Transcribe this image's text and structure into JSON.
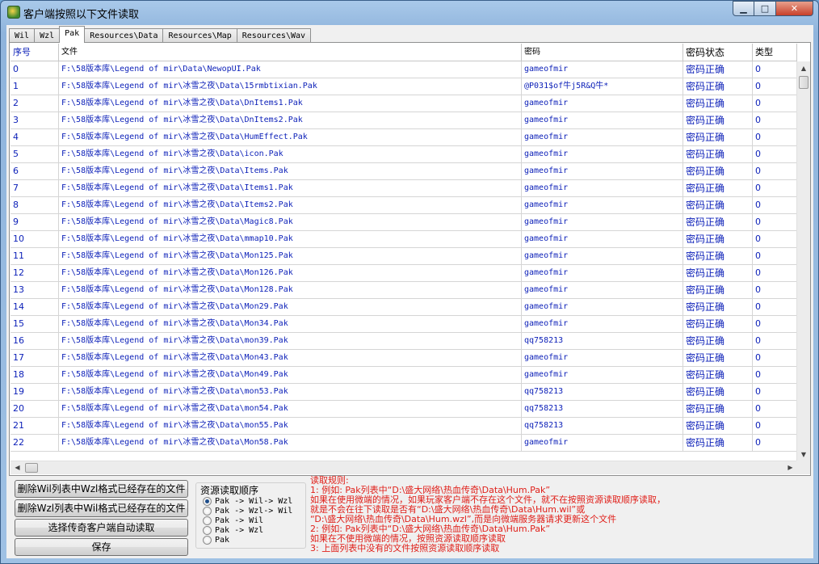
{
  "window": {
    "title": "客户端按照以下文件读取",
    "min_glyph": "▁",
    "max_glyph": "□",
    "close_glyph": "✕"
  },
  "tabs": [
    "Wil",
    "Wzl",
    "Pak",
    "Resources\\Data",
    "Resources\\Map",
    "Resources\\Wav"
  ],
  "active_tab": 2,
  "table": {
    "headers": [
      "序号",
      "文件",
      "密码",
      "密码状态",
      "类型"
    ],
    "rows": [
      [
        "0",
        "F:\\58版本库\\Legend of mir\\Data\\NewopUI.Pak",
        "gameofmir",
        "密码正确",
        "0"
      ],
      [
        "1",
        "F:\\58版本库\\Legend of mir\\冰雪之夜\\Data\\15rmbtixian.Pak",
        "@P031$of牛j5R&Q牛*",
        "密码正确",
        "0"
      ],
      [
        "2",
        "F:\\58版本库\\Legend of mir\\冰雪之夜\\Data\\DnItems1.Pak",
        "gameofmir",
        "密码正确",
        "0"
      ],
      [
        "3",
        "F:\\58版本库\\Legend of mir\\冰雪之夜\\Data\\DnItems2.Pak",
        "gameofmir",
        "密码正确",
        "0"
      ],
      [
        "4",
        "F:\\58版本库\\Legend of mir\\冰雪之夜\\Data\\HumEffect.Pak",
        "gameofmir",
        "密码正确",
        "0"
      ],
      [
        "5",
        "F:\\58版本库\\Legend of mir\\冰雪之夜\\Data\\icon.Pak",
        "gameofmir",
        "密码正确",
        "0"
      ],
      [
        "6",
        "F:\\58版本库\\Legend of mir\\冰雪之夜\\Data\\Items.Pak",
        "gameofmir",
        "密码正确",
        "0"
      ],
      [
        "7",
        "F:\\58版本库\\Legend of mir\\冰雪之夜\\Data\\Items1.Pak",
        "gameofmir",
        "密码正确",
        "0"
      ],
      [
        "8",
        "F:\\58版本库\\Legend of mir\\冰雪之夜\\Data\\Items2.Pak",
        "gameofmir",
        "密码正确",
        "0"
      ],
      [
        "9",
        "F:\\58版本库\\Legend of mir\\冰雪之夜\\Data\\Magic8.Pak",
        "gameofmir",
        "密码正确",
        "0"
      ],
      [
        "10",
        "F:\\58版本库\\Legend of mir\\冰雪之夜\\Data\\mmap10.Pak",
        "gameofmir",
        "密码正确",
        "0"
      ],
      [
        "11",
        "F:\\58版本库\\Legend of mir\\冰雪之夜\\Data\\Mon125.Pak",
        "gameofmir",
        "密码正确",
        "0"
      ],
      [
        "12",
        "F:\\58版本库\\Legend of mir\\冰雪之夜\\Data\\Mon126.Pak",
        "gameofmir",
        "密码正确",
        "0"
      ],
      [
        "13",
        "F:\\58版本库\\Legend of mir\\冰雪之夜\\Data\\Mon128.Pak",
        "gameofmir",
        "密码正确",
        "0"
      ],
      [
        "14",
        "F:\\58版本库\\Legend of mir\\冰雪之夜\\Data\\Mon29.Pak",
        "gameofmir",
        "密码正确",
        "0"
      ],
      [
        "15",
        "F:\\58版本库\\Legend of mir\\冰雪之夜\\Data\\Mon34.Pak",
        "gameofmir",
        "密码正确",
        "0"
      ],
      [
        "16",
        "F:\\58版本库\\Legend of mir\\冰雪之夜\\Data\\mon39.Pak",
        "qq758213",
        "密码正确",
        "0"
      ],
      [
        "17",
        "F:\\58版本库\\Legend of mir\\冰雪之夜\\Data\\Mon43.Pak",
        "gameofmir",
        "密码正确",
        "0"
      ],
      [
        "18",
        "F:\\58版本库\\Legend of mir\\冰雪之夜\\Data\\Mon49.Pak",
        "gameofmir",
        "密码正确",
        "0"
      ],
      [
        "19",
        "F:\\58版本库\\Legend of mir\\冰雪之夜\\Data\\mon53.Pak",
        "qq758213",
        "密码正确",
        "0"
      ],
      [
        "20",
        "F:\\58版本库\\Legend of mir\\冰雪之夜\\Data\\mon54.Pak",
        "qq758213",
        "密码正确",
        "0"
      ],
      [
        "21",
        "F:\\58版本库\\Legend of mir\\冰雪之夜\\Data\\mon55.Pak",
        "qq758213",
        "密码正确",
        "0"
      ],
      [
        "22",
        "F:\\58版本库\\Legend of mir\\冰雪之夜\\Data\\Mon58.Pak",
        "gameofmir",
        "密码正确",
        "0"
      ]
    ]
  },
  "buttons": {
    "delete_wil": "删除Wil列表中Wzl格式已经存在的文件",
    "delete_wzl": "删除Wzl列表中Wil格式已经存在的文件",
    "select_client": "选择传奇客户端自动读取",
    "save": "保存"
  },
  "order": {
    "title": "资源读取顺序",
    "options": [
      "Pak -> Wil-> Wzl",
      "Pak -> Wzl-> Wil",
      "Pak -> Wil",
      "Pak -> Wzl",
      "Pak"
    ],
    "selected": 0
  },
  "rules": {
    "lines": [
      "读取规则:",
      "1: 例如: Pak列表中“D:\\盛大网络\\热血传奇\\Data\\Hum.Pak”",
      "      如果在使用微端的情况，如果玩家客户端不存在这个文件，就不在按照资源读取顺序读取，",
      "      就是不会在往下读取是否有“D:\\盛大网络\\热血传奇\\Data\\Hum.wil”或",
      "    “D:\\盛大网络\\热血传奇\\Data\\Hum.wzl”,而是向微端服务器请求更新这个文件",
      "2: 例如: Pak列表中“D:\\盛大网络\\热血传奇\\Data\\Hum.Pak”",
      "      如果在不使用微端的情况，按照资源读取顺序读取",
      "3: 上面列表中没有的文件按照资源读取顺序读取"
    ]
  },
  "colors": {
    "cell_text": "#0b1fb8",
    "rules_text": "#e0201a"
  }
}
